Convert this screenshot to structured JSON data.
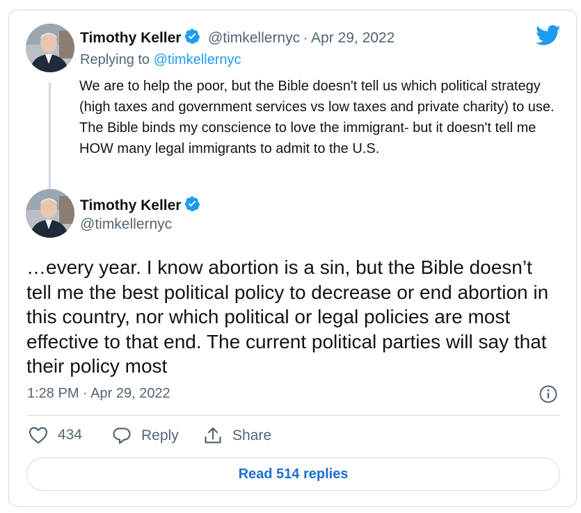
{
  "reply_tweet": {
    "author_name": "Timothy Keller",
    "author_handle": "@timkellernyc",
    "separator": "·",
    "date": "Apr 29, 2022",
    "replying_prefix": "Replying to ",
    "replying_handle": "@timkellernyc",
    "text": "We are to help the poor, but the Bible doesn't tell us which political strategy (high taxes and government services vs low taxes and private charity) to use. The Bible binds my conscience to love the immigrant- but it doesn't tell me HOW many legal immigrants to admit to the U.S."
  },
  "main_tweet": {
    "author_name": "Timothy Keller",
    "author_handle": "@timkellernyc",
    "text": "…every year. I know abortion is a sin, but the Bible doesn’t tell me the best political policy to decrease or end abortion in this country, nor which political or legal policies are most effective to that end. The current political parties will say that their policy most",
    "timestamp": "1:28 PM · Apr 29, 2022"
  },
  "actions": {
    "like_count": "434",
    "reply_label": "Reply",
    "share_label": "Share"
  },
  "read_replies_label": "Read 514 replies",
  "icons": {
    "brand": "twitter-bird-icon",
    "verified": "verified-badge-icon",
    "info": "info-icon",
    "like": "heart-icon",
    "reply": "reply-bubble-icon",
    "share": "share-icon"
  },
  "colors": {
    "accent": "#1d9bf0",
    "text": "#0f1419",
    "muted": "#536471",
    "border": "#cfd9de"
  }
}
